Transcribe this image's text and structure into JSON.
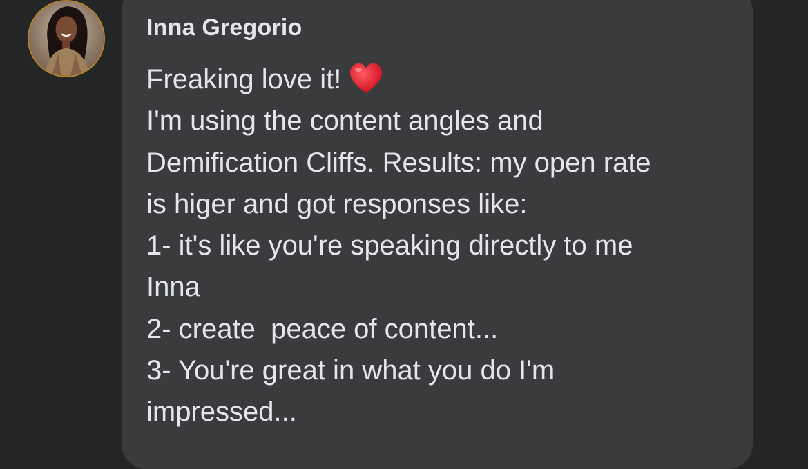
{
  "comment": {
    "author": "Inna Gregorio",
    "avatar_icon": "profile-photo",
    "reaction_icon": "red-heart-emoji",
    "lines": [
      "Freaking love it!",
      "I'm using the content angles and",
      "Demification Cliffs. Results: my open rate",
      "is higer and got responses like:",
      "1- it's like you're speaking directly to me",
      "Inna",
      "2- create  peace of content...",
      "3- You're great in what you do I'm",
      "impressed..."
    ]
  },
  "colors": {
    "background": "#242526",
    "bubble": "#3a3b3c",
    "text": "#e4e6eb",
    "avatar_ring": "#b5852f",
    "heart": "#e0242f"
  }
}
